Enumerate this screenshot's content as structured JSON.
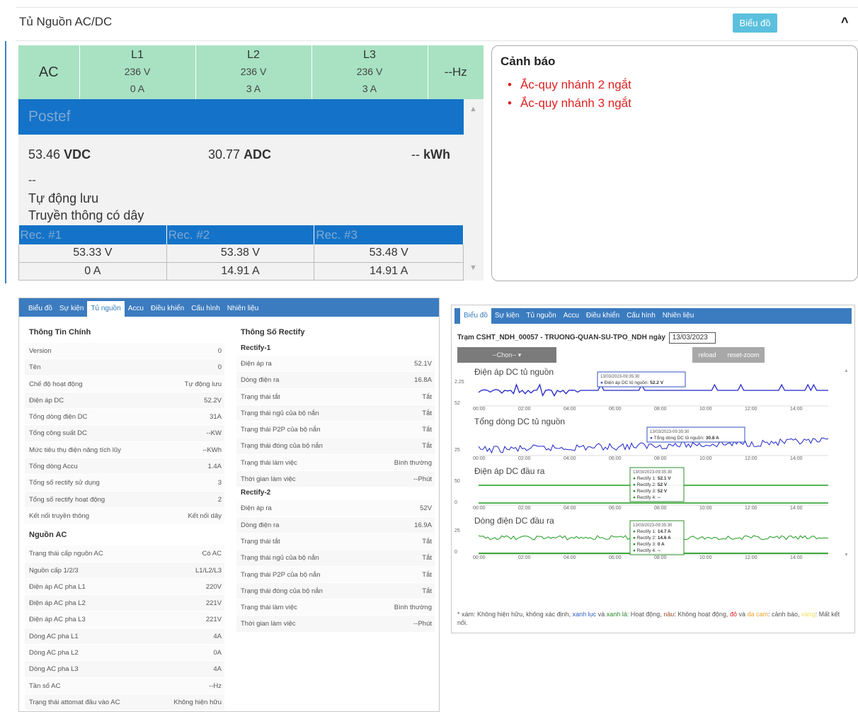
{
  "header": {
    "title": "Tủ Nguồn AC/DC",
    "chart_button": "Biểu đồ",
    "collapse_icon": "chevron-up-icon"
  },
  "ac": {
    "label": "AC",
    "frequency": "--Hz",
    "phases": [
      {
        "name": "L1",
        "voltage": "236 V",
        "current": "0 A"
      },
      {
        "name": "L2",
        "voltage": "236 V",
        "current": "3 A"
      },
      {
        "name": "L3",
        "voltage": "236 V",
        "current": "3 A"
      }
    ]
  },
  "postef": {
    "name": "Postef",
    "vdc_value": "53.46",
    "vdc_unit": "VDC",
    "adc_value": "30.77",
    "adc_unit": "ADC",
    "kwh_value": "--",
    "kwh_unit": "kWh",
    "status_dash": "--",
    "mode": "Tự động lưu",
    "comm": "Truyền thông có dây"
  },
  "rectifiers": [
    {
      "label": "Rec. #1",
      "voltage": "53.33 V",
      "current": "0 A"
    },
    {
      "label": "Rec. #2",
      "voltage": "53.38 V",
      "current": "14.91 A"
    },
    {
      "label": "Rec. #3",
      "voltage": "53.48 V",
      "current": "14.91 A"
    }
  ],
  "alerts": {
    "title": "Cảnh báo",
    "items": [
      "Ắc-quy nhánh 2 ngắt",
      "Ắc-quy nhánh 3 ngắt"
    ]
  },
  "left_tabs": [
    "Biểu đồ",
    "Sự kiện",
    "Tủ nguồn",
    "Accu",
    "Điều khiển",
    "Cấu hình",
    "Nhiên liệu"
  ],
  "left_active_tab": "Tủ nguồn",
  "info": {
    "title": "Thông Tin Chính",
    "rows": [
      [
        "Version",
        "0"
      ],
      [
        "Tên",
        "0"
      ],
      [
        "Chế độ hoạt động",
        "Tự động lưu"
      ],
      [
        "Điện áp DC",
        "52.2V"
      ],
      [
        "Tổng dòng điện DC",
        "31A"
      ],
      [
        "Tổng công suất DC",
        "--KW"
      ],
      [
        "Mức tiêu thụ điện năng tích lũy",
        "--KWh"
      ],
      [
        "Tổng dòng Accu",
        "1.4A"
      ],
      [
        "Tổng số rectify sử dụng",
        "3"
      ],
      [
        "Tổng số rectify hoạt động",
        "2"
      ],
      [
        "Kết nối truyền thông",
        "Kết nối dây"
      ]
    ],
    "ac_title": "Nguồn AC",
    "ac_rows": [
      [
        "Trạng thái cấp nguồn AC",
        "Có AC"
      ],
      [
        "Nguồn cấp 1/2/3",
        "L1/L2/L3"
      ],
      [
        "Điện áp AC pha L1",
        "220V"
      ],
      [
        "Điện áp AC pha L2",
        "221V"
      ],
      [
        "Điện áp AC pha L3",
        "221V"
      ],
      [
        "Dòng AC pha L1",
        "4A"
      ],
      [
        "Dòng AC pha L2",
        "0A"
      ],
      [
        "Dòng AC pha L3",
        "4A"
      ],
      [
        "Tần số AC",
        "--Hz"
      ],
      [
        "Trạng thái attomat đầu vào AC",
        "Không hiện hữu"
      ]
    ]
  },
  "rectify": {
    "title": "Thông Số Rectify",
    "groups": [
      {
        "name": "Rectify-1",
        "rows": [
          [
            "Điện áp ra",
            "52.1V"
          ],
          [
            "Dòng điện ra",
            "16.8A"
          ],
          [
            "Trạng thái tắt",
            "Tắt"
          ],
          [
            "Trạng thái ngủ của bộ nắn",
            "Tắt"
          ],
          [
            "Trạng thái P2P của bộ nắn",
            "Tắt"
          ],
          [
            "Trạng thái đóng của bộ nắn",
            "Tắt"
          ],
          [
            "Trạng thái làm việc",
            "Bình thường"
          ],
          [
            "Thời gian làm việc",
            "--Phút"
          ]
        ]
      },
      {
        "name": "Rectify-2",
        "rows": [
          [
            "Điện áp ra",
            "52V"
          ],
          [
            "Dòng điện ra",
            "16.9A"
          ],
          [
            "Trạng thái tắt",
            "Tắt"
          ],
          [
            "Trạng thái ngủ của bộ nắn",
            "Tắt"
          ],
          [
            "Trạng thái P2P của bộ nắn",
            "Tắt"
          ],
          [
            "Trạng thái đóng của bộ nắn",
            "Tắt"
          ],
          [
            "Trạng thái làm việc",
            "Bình thường"
          ],
          [
            "Thời gian làm việc",
            "--Phút"
          ]
        ]
      }
    ]
  },
  "right_tabs": [
    "Biểu đồ",
    "Sự kiện",
    "Tủ nguồn",
    "Accu",
    "Điều khiển",
    "Cấu hình",
    "Nhiên liệu"
  ],
  "right_active_tab": "Biểu đồ",
  "station": {
    "label": "Trạm CSHT_NDH_00057 - TRUONG-QUAN-SU-TPO_NDH ngày",
    "date": "13/03/2023"
  },
  "controls": {
    "select": "--Chọn-- ▾",
    "reload": "reload",
    "reset_zoom": "reset-zoom"
  },
  "chart_data": [
    {
      "type": "line",
      "title": "Điện áp DC tủ nguồn",
      "x_ticks": [
        "00:00",
        "02:00",
        "04:00",
        "06:00",
        "08:00",
        "10:00",
        "12:00",
        "14:00"
      ],
      "y_ticks": [
        "2.25",
        "52"
      ],
      "color": "#1f24c8",
      "tooltip": {
        "time": "13/03/2023-09:35:30",
        "lines": [
          {
            "label": "Điện áp DC tủ nguồn:",
            "value": "52.2 V"
          }
        ]
      }
    },
    {
      "type": "line",
      "title": "Tổng dòng DC tủ nguồn",
      "x_ticks": [
        "00:00",
        "02:00",
        "04:00",
        "06:00",
        "08:00",
        "10:00",
        "12:00",
        "14:00"
      ],
      "y_ticks": [
        "25"
      ],
      "color": "#1f24c8",
      "tooltip": {
        "time": "13/03/2023-09:35:30",
        "lines": [
          {
            "label": "Tổng dòng DC tủ nguồn:",
            "value": "30.8 A"
          }
        ]
      }
    },
    {
      "type": "line",
      "title": "Điện áp DC đầu ra",
      "x_ticks": [
        "00:00",
        "02:00",
        "04:00",
        "06:00",
        "08:00",
        "10:00",
        "12:00",
        "14:00"
      ],
      "y_ticks": [
        "50",
        "0"
      ],
      "color": "#1e9c1e",
      "tooltip": {
        "time": "13/03/2023-09:35:30",
        "lines": [
          {
            "label": "Rectify 1:",
            "value": "52.1 V"
          },
          {
            "label": "Rectify 2:",
            "value": "52 V"
          },
          {
            "label": "Rectify 3:",
            "value": "52 V"
          },
          {
            "label": "Rectify 4:",
            "value": "--"
          }
        ]
      }
    },
    {
      "type": "line",
      "title": "Dòng điện DC đầu ra",
      "x_ticks": [
        "00:00",
        "02:00",
        "04:00",
        "06:00",
        "08:00",
        "10:00",
        "12:00",
        "14:00"
      ],
      "y_ticks": [
        "25",
        "0"
      ],
      "color": "#1e9c1e",
      "tooltip": {
        "time": "13/03/2023-09:35:30",
        "lines": [
          {
            "label": "Rectify 1:",
            "value": "14.7 A"
          },
          {
            "label": "Rectify 2:",
            "value": "14.6 A"
          },
          {
            "label": "Rectify 3:",
            "value": "0 A"
          },
          {
            "label": "Rectify 4:",
            "value": "--"
          }
        ]
      }
    }
  ],
  "legend": {
    "prefix": "* xám: Không hiện hữu, không xác định,",
    "green1": "xanh lục",
    "and1": "và",
    "green2": "xanh lá",
    "mid": ": Hoạt động,",
    "brown": "nâu",
    "mid2": ": Không hoạt động,",
    "red": "đỏ",
    "and2": "và",
    "orange": "da cam",
    "mid3": ": cảnh báo,",
    "yellow": "vàng",
    "suffix": ": Mất kết nối."
  }
}
